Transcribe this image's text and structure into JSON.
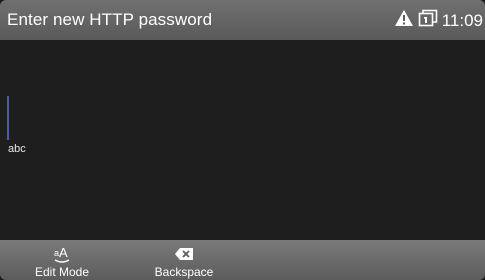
{
  "header": {
    "title": "Enter new HTTP password",
    "time": "11:09",
    "icons": [
      "warning-icon",
      "window-icon"
    ]
  },
  "input": {
    "mode": "abc",
    "value": ""
  },
  "softkeys": [
    {
      "label": "Edit Mode",
      "icon": "edit-mode-icon"
    },
    {
      "label": "Backspace",
      "icon": "backspace-icon"
    }
  ],
  "colors": {
    "header_bg": "#666666",
    "body_bg": "#1e1e1e",
    "cursor": "#4a5a9a",
    "text": "#ffffff"
  }
}
